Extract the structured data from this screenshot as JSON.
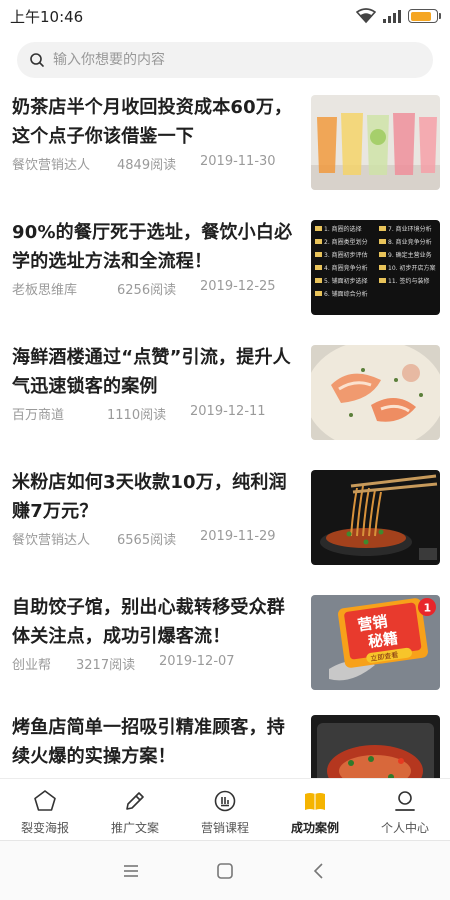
{
  "status_bar": {
    "time": "上午10:46",
    "battery_percent": 80
  },
  "search": {
    "placeholder": "输入你想要的内容"
  },
  "articles": [
    {
      "title": "奶茶店半个月收回投资成本60万，这个点子你该借鉴一下",
      "author": "餐饮营销达人",
      "reads": "4849阅读",
      "date": "2019-11-30"
    },
    {
      "title": "90%的餐厅死于选址，餐饮小白必学的选址方法和全流程！",
      "author": "老板思维库",
      "reads": "6256阅读",
      "date": "2019-12-25"
    },
    {
      "title": "海鲜酒楼通过“点赞”引流，提升人气迅速锁客的案例",
      "author": "百万商道",
      "reads": "1110阅读",
      "date": "2019-12-11"
    },
    {
      "title": "米粉店如何3天收款10万，纯利润赚7万元？",
      "author": "餐饮营销达人",
      "reads": "6565阅读",
      "date": "2019-11-29"
    },
    {
      "title": "自助饺子馆，别出心裁转移受众群体关注点，成功引爆客流！",
      "author": "创业帮",
      "reads": "3217阅读",
      "date": "2019-12-07"
    },
    {
      "title": "烤鱼店简单一招吸引精准顾客，持续火爆的实操方案！",
      "author": "",
      "reads": "",
      "date": ""
    }
  ],
  "thumb_texts": {
    "site_list": [
      "1. 商圈的选择",
      "2. 商圈类型划分",
      "3. 商圈初步评估",
      "4. 商圈竞争分析",
      "5. 铺面初步选择",
      "6. 铺面综合分析",
      "7. 商业环境分析",
      "8. 商业竞争分析",
      "9. 确定主营业务",
      "10. 初步开店方案",
      "11. 签约与装修"
    ],
    "badge_line1": "营销",
    "badge_line2": "秘籍",
    "badge_sub": "立即查看",
    "badge_count": "1"
  },
  "bottom_nav": [
    {
      "label": "裂变海报",
      "icon": "pentagon-icon",
      "active": false
    },
    {
      "label": "推广文案",
      "icon": "pencil-icon",
      "active": false
    },
    {
      "label": "营销课程",
      "icon": "course-icon",
      "active": false
    },
    {
      "label": "成功案例",
      "icon": "book-icon",
      "active": true
    },
    {
      "label": "个人中心",
      "icon": "user-icon",
      "active": false
    }
  ],
  "colors": {
    "accent": "#f5b400",
    "text": "#1f1f1f",
    "meta": "#9a9a9a",
    "battery": "#f5a623"
  }
}
